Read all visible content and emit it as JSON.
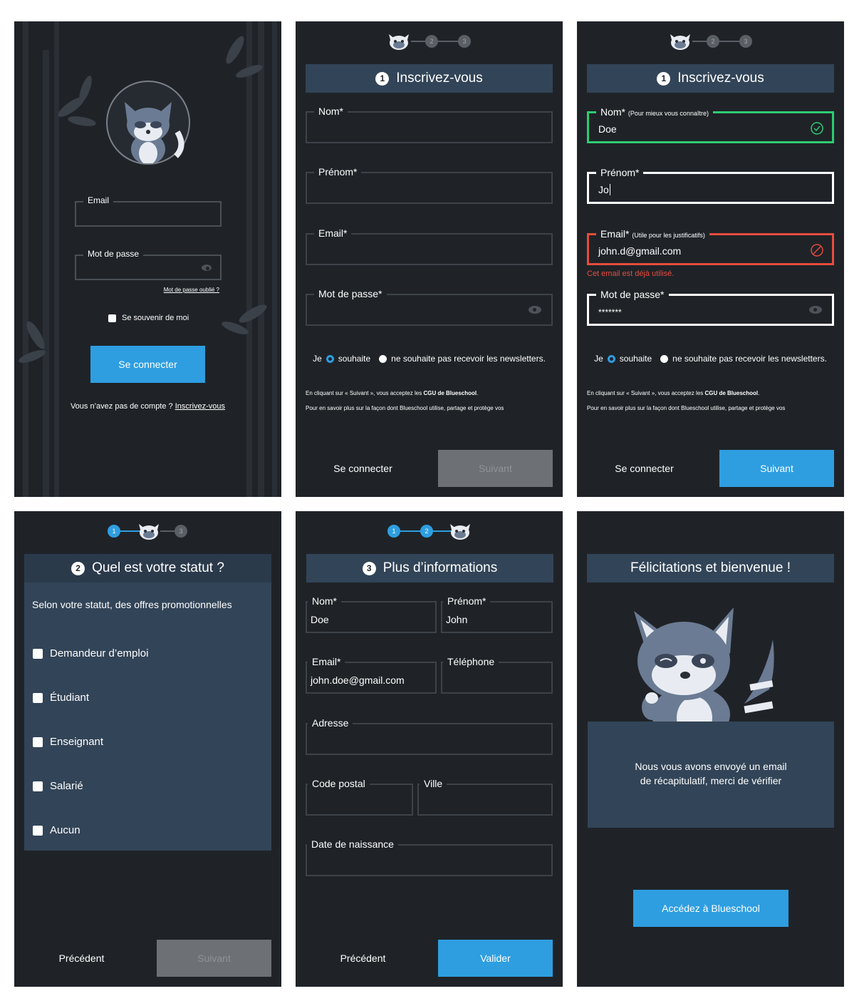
{
  "login": {
    "email_label": "Email",
    "password_label": "Mot de passe",
    "forgot": "Mot de passe oublié ?",
    "remember": "Se souvenir de moi",
    "submit": "Se connecter",
    "no_account": "Vous n’avez pas de compte ?",
    "signup_link": "Inscrivez-vous"
  },
  "signup": {
    "step_num": "1",
    "title": "Inscrivez-vous",
    "progress": [
      "2",
      "3"
    ],
    "nom_label": "Nom*",
    "prenom_label": "Prénom*",
    "email_label": "Email*",
    "password_label": "Mot de passe*",
    "radio_je": "Je",
    "radio_yes": "souhaite",
    "radio_no": "ne souhaite pas recevoir les newsletters.",
    "legal_1a": "En cliquant sur « Suivant », vous acceptez les ",
    "legal_1b": "CGU de Blueschool",
    "legal_1c": ".",
    "legal_2": "Pour en savoir plus sur la façon dont Blueschool utilise, partage et protège vos",
    "login_btn": "Se connecter",
    "next_btn": "Suivant"
  },
  "signup_filled": {
    "nom_hint": "(Pour mieux vous connaître)",
    "nom_value": "Doe",
    "prenom_value": "Jo",
    "email_hint": "(Utile pour les justificatifs)",
    "email_value": "john.d@gmail.com",
    "email_error": "Cet email est déjà utilisé.",
    "password_value": "*******",
    "colors": {
      "valid": "#2ecc71",
      "error": "#e74c3c",
      "accent": "#2e9ee0"
    }
  },
  "status": {
    "step_num": "2",
    "title": "Quel est votre statut ?",
    "progress": [
      "1",
      "3"
    ],
    "intro": "Selon votre statut, des offres promotionnelles",
    "options": [
      "Demandeur d’emploi",
      "Étudiant",
      "Enseignant",
      "Salarié",
      "Aucun"
    ],
    "prev_btn": "Précédent",
    "next_btn": "Suivant"
  },
  "more_info": {
    "step_num": "3",
    "title": "Plus d’informations",
    "progress": [
      "1",
      "2"
    ],
    "nom_label": "Nom*",
    "nom_value": "Doe",
    "prenom_label": "Prénom*",
    "prenom_value": "John",
    "email_label": "Email*",
    "email_value": "john.doe@gmail.com",
    "phone_label": "Téléphone",
    "address_label": "Adresse",
    "zip_label": "Code postal",
    "city_label": "Ville",
    "birth_label": "Date de naissance",
    "prev_btn": "Précédent",
    "submit_btn": "Valider"
  },
  "welcome": {
    "title": "Félicitations et bienvenue !",
    "message_1": "Nous vous avons envoyé un email",
    "message_2": "de récapitulatif, merci de vérifier",
    "cta": "Accédez à Blueschool"
  }
}
